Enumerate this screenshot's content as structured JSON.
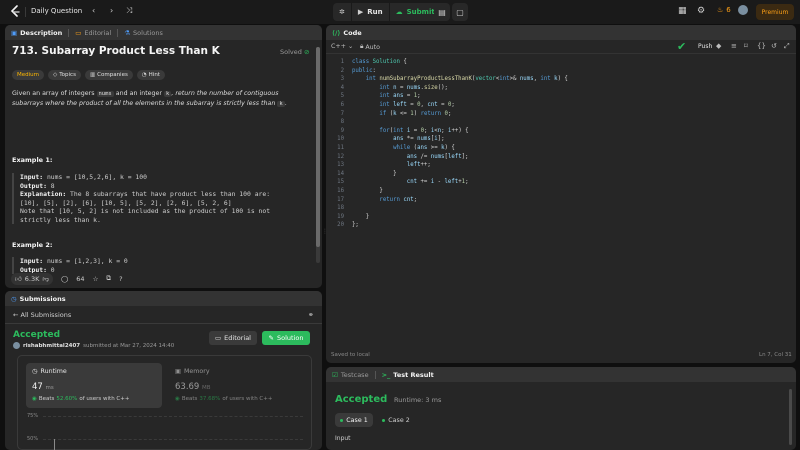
{
  "topbar": {
    "title": "Daily Question",
    "run_label": "Run",
    "submit_label": "Submit",
    "streak_count": "6",
    "premium_label": "Premium"
  },
  "description": {
    "tabs": [
      {
        "label": "Description",
        "icon": "description-icon"
      },
      {
        "label": "Editorial",
        "icon": "editorial-icon"
      },
      {
        "label": "Solutions",
        "icon": "flask-icon"
      }
    ],
    "title": "713. Subarray Product Less Than K",
    "solved_label": "Solved",
    "tags": [
      "Medium",
      "Topics",
      "Companies",
      "Hint"
    ],
    "para_1": "Given an array of integers",
    "para_code_1": "nums",
    "para_2": "and an integer",
    "para_code_2": "k",
    "para_3": ", return the number of contiguous subarrays where the product of all the elements in the subarray is strictly less than",
    "para_code_3": "k",
    "para_4": ".",
    "example1_title": "Example 1:",
    "example1_input_label": "Input:",
    "example1_input": " nums = [10,5,2,6], k = 100",
    "example1_output_label": "Output:",
    "example1_output": " 8",
    "example1_expl_label": "Explanation:",
    "example1_expl": " The 8 subarrays that have product less than 100 are:\n[10], [5], [2], [6], [10, 5], [5, 2], [2, 6], [5, 2, 6]\nNote that [10, 5, 2] is not included as the product of 100 is not\nstrictly less than k.",
    "example2_title": "Example 2:",
    "example2_input_label": "Input:",
    "example2_input": " nums = [1,2,3], k = 0",
    "example2_output_label": "Output:",
    "example2_output": " 0",
    "likes": "6.3K",
    "comments": "64"
  },
  "submissions": {
    "tab_label": "Submissions",
    "back_label": "All Submissions",
    "status": "Accepted",
    "user": "rishabhmittal2407",
    "submitted_text": "submitted at Mar 27, 2024 14:40",
    "editorial_btn": "Editorial",
    "solution_btn": "Solution",
    "runtime_label": "Runtime",
    "runtime_value": "47",
    "runtime_unit": "ms",
    "runtime_beats_prefix": "Beats",
    "runtime_beats": "52.60%",
    "runtime_beats_suffix": "of users with C++",
    "memory_label": "Memory",
    "memory_value": "63.69",
    "memory_unit": "MB",
    "memory_beats_prefix": "Beats",
    "memory_beats": "37.68%",
    "memory_beats_suffix": "of users with C++",
    "chart_y1": "75%",
    "chart_y2": "50%"
  },
  "code": {
    "tab_label": "Code",
    "language": "C++",
    "auto_label": "Auto",
    "push_label": "Push",
    "status_text": "Saved to local",
    "cursor_pos": "Ln 7, Col 31",
    "lines": [
      "class Solution {",
      "public:",
      "    int numSubarrayProductLessThanK(vector<int>& nums, int k) {",
      "        int n = nums.size();",
      "        int ans = 1;",
      "        int left = 0, cnt = 0;",
      "        if (k <= 1) return 0;",
      "",
      "        for(int i = 0; i<n; i++) {",
      "            ans *= nums[i];",
      "            while (ans >= k) {",
      "                ans /= nums[left];",
      "                left++;",
      "            }",
      "                cnt += i - left+1;",
      "        }",
      "        return cnt;",
      "",
      "    }",
      "};"
    ]
  },
  "test": {
    "tab_testcase": "Testcase",
    "tab_result": "Test Result",
    "status": "Accepted",
    "runtime_text": "Runtime: 3 ms",
    "case1": "Case 1",
    "case2": "Case 2",
    "input_label": "Input"
  },
  "colors": {
    "accent_green": "#2cbb5d",
    "accent_orange": "#ffa116",
    "medium_yellow": "#ffb800"
  }
}
